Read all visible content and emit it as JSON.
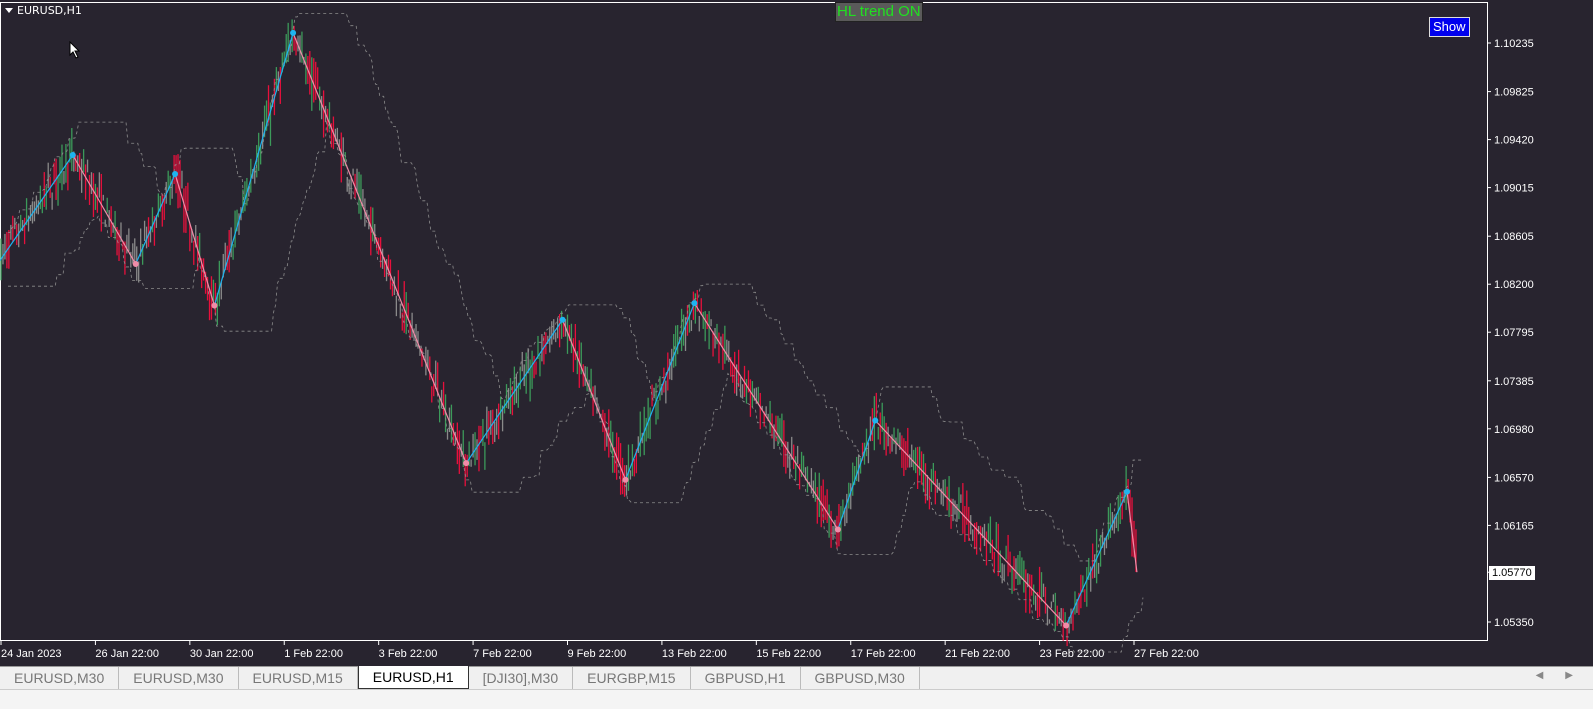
{
  "window": {
    "symbol_title": "EURUSD,H1"
  },
  "indicator": {
    "status_label": "HL trend ON",
    "show_button": "Show"
  },
  "tabs": [
    {
      "label": "EURUSD,M30",
      "active": false
    },
    {
      "label": "EURUSD,M30",
      "active": false
    },
    {
      "label": "EURUSD,M15",
      "active": false
    },
    {
      "label": "EURUSD,H1",
      "active": true
    },
    {
      "label": "[DJI30],M30",
      "active": false
    },
    {
      "label": "EURGBP,M15",
      "active": false
    },
    {
      "label": "GBPUSD,H1",
      "active": false
    },
    {
      "label": "GBPUSD,M30",
      "active": false
    }
  ],
  "chart_data": {
    "type": "candlestick",
    "symbol": "EURUSD",
    "timeframe": "H1",
    "current_price": "1.05770",
    "ylim": [
      1.052,
      1.1055
    ],
    "y_ticks": [
      "1.10235",
      "1.09825",
      "1.09420",
      "1.09015",
      "1.08605",
      "1.08200",
      "1.07795",
      "1.07385",
      "1.06980",
      "1.06570",
      "1.06165",
      "1.05770",
      "1.05350"
    ],
    "x_ticks": [
      {
        "label": "24 Jan 2023",
        "time": "2023-01-24 22:00"
      },
      {
        "label": "26 Jan 22:00",
        "time": "2023-01-26 22:00"
      },
      {
        "label": "30 Jan 22:00",
        "time": "2023-01-30 22:00"
      },
      {
        "label": "1 Feb 22:00",
        "time": "2023-02-01 22:00"
      },
      {
        "label": "3 Feb 22:00",
        "time": "2023-02-03 22:00"
      },
      {
        "label": "7 Feb 22:00",
        "time": "2023-02-07 22:00"
      },
      {
        "label": "9 Feb 22:00",
        "time": "2023-02-09 22:00"
      },
      {
        "label": "13 Feb 22:00",
        "time": "2023-02-13 22:00"
      },
      {
        "label": "15 Feb 22:00",
        "time": "2023-02-15 22:00"
      },
      {
        "label": "17 Feb 22:00",
        "time": "2023-02-17 22:00"
      },
      {
        "label": "21 Feb 22:00",
        "time": "2023-02-21 22:00"
      },
      {
        "label": "23 Feb 22:00",
        "time": "2023-02-23 22:00"
      },
      {
        "label": "27 Feb 22:00",
        "time": "2023-02-27 22:00"
      }
    ],
    "zigzag": [
      {
        "time": "2023-01-24 22:00",
        "price": 1.084,
        "type": "start"
      },
      {
        "time": "2023-01-26 11:00",
        "price": 1.0929,
        "type": "high"
      },
      {
        "time": "2023-01-27 19:00",
        "price": 1.0837,
        "type": "low"
      },
      {
        "time": "2023-01-30 15:00",
        "price": 1.0913,
        "type": "high"
      },
      {
        "time": "2023-01-31 11:00",
        "price": 1.0802,
        "type": "low"
      },
      {
        "time": "2023-02-02 03:00",
        "price": 1.1032,
        "type": "high"
      },
      {
        "time": "2023-02-07 19:00",
        "price": 1.0669,
        "type": "low"
      },
      {
        "time": "2023-02-09 20:00",
        "price": 1.079,
        "type": "high"
      },
      {
        "time": "2023-02-13 04:00",
        "price": 1.0655,
        "type": "low"
      },
      {
        "time": "2023-02-14 15:00",
        "price": 1.0804,
        "type": "high"
      },
      {
        "time": "2023-02-17 16:00",
        "price": 1.0613,
        "type": "low"
      },
      {
        "time": "2023-02-20 11:00",
        "price": 1.0705,
        "type": "high"
      },
      {
        "time": "2023-02-24 12:00",
        "price": 1.0532,
        "type": "low"
      },
      {
        "time": "2023-02-27 19:00",
        "price": 1.0645,
        "type": "high"
      },
      {
        "time": "2023-02-28 00:00",
        "price": 1.0577,
        "type": "last"
      }
    ],
    "colors": {
      "background": "#28242f",
      "bull": "#3c9a5a",
      "bear": "#e8103c",
      "neutral": "#8a8a8a",
      "zigzag_up": "#1eb4f0",
      "zigzag_down": "#f08ca8",
      "channel": "#8c8c8c"
    }
  }
}
